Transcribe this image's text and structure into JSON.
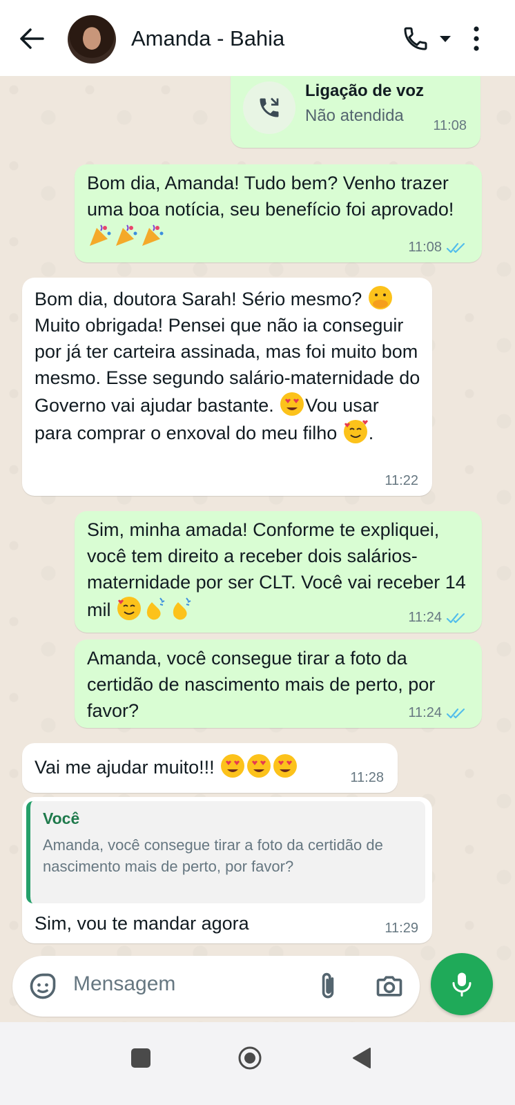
{
  "header": {
    "contact_name": "Amanda - Bahia",
    "icons": [
      "back-arrow-icon",
      "avatar",
      "phone-icon",
      "dropdown-caret-icon",
      "more-vertical-icon"
    ]
  },
  "call": {
    "title": "Ligação de voz",
    "status": "Não atendida",
    "time": "11:08",
    "icon": "missed-call-icon"
  },
  "messages": [
    {
      "dir": "out",
      "text": "Bom dia, Amanda! Tudo bem? Venho trazer uma boa notícia, seu benefício foi aprovado!",
      "emojis": [
        "party-popper",
        "party-popper",
        "party-popper"
      ],
      "time": "11:08",
      "read": true
    },
    {
      "dir": "in",
      "text": "Bom dia, doutora Sarah! Sério mesmo? Muito obrigada! Pensei que não ia conseguir por já ter carteira assinada, mas foi muito bom mesmo. Esse segundo salário-maternidade do Governo vai ajudar bastante. Vou usar para comprar o enxoval do meu filho .",
      "time": "11:22"
    },
    {
      "dir": "out",
      "text": "Sim, minha amada! Conforme te expliquei, você tem direito a receber dois salários-maternidade por ser CLT. Você vai receber 14 mil",
      "time": "11:24",
      "read": true
    },
    {
      "dir": "out",
      "text": "Amanda, você consegue tirar a foto da certidão de nascimento mais de perto, por favor?",
      "time": "11:24",
      "read": true
    },
    {
      "dir": "in",
      "text": "Vai me ajudar muito!!!",
      "time": "11:28"
    },
    {
      "dir": "in",
      "quote_author": "Você",
      "quote_text": "Amanda, você consegue tirar a foto da certidão de nascimento mais de perto, por favor?",
      "text": "Sim, vou te mandar agora",
      "time": "11:29"
    }
  ],
  "composer": {
    "placeholder": "Mensagem",
    "icons": [
      "sticker-icon",
      "paperclip-icon",
      "camera-icon",
      "microphone-icon"
    ]
  },
  "colors": {
    "outgoing": "#d9fdd3",
    "incoming": "#ffffff",
    "accent": "#1faa59",
    "ticks": "#53bdeb"
  }
}
